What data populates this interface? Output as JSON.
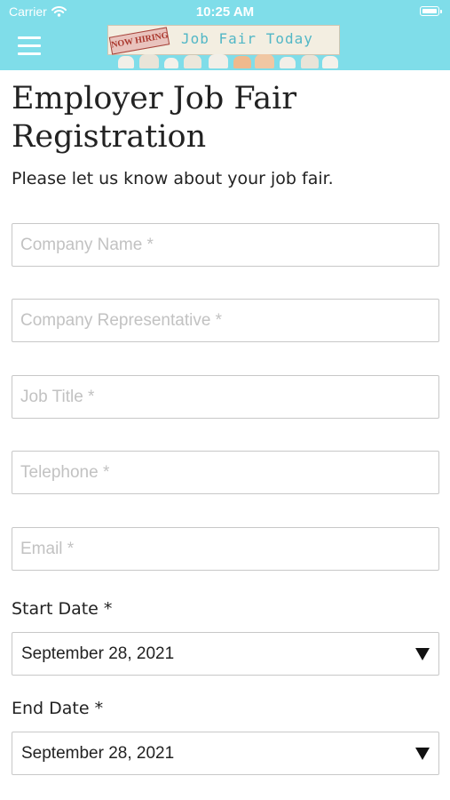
{
  "status_bar": {
    "carrier": "Carrier",
    "time": "10:25 AM"
  },
  "header": {
    "logo_badge": "NOW HIRING",
    "logo_title": "Job Fair Today",
    "colors": {
      "bar": "#7fdde9",
      "logo_title": "#52b7c6"
    }
  },
  "page": {
    "title": "Employer Job Fair Registration",
    "subtitle": "Please let us know about your job fair."
  },
  "form": {
    "fields": [
      {
        "placeholder": "Company Name *",
        "value": ""
      },
      {
        "placeholder": "Company Representative *",
        "value": ""
      },
      {
        "placeholder": "Job Title *",
        "value": ""
      },
      {
        "placeholder": "Telephone *",
        "value": ""
      },
      {
        "placeholder": "Email *",
        "value": ""
      }
    ],
    "start_date": {
      "label": "Start Date *",
      "selected": "September 28, 2021"
    },
    "end_date": {
      "label": "End Date *",
      "selected": "September 28, 2021"
    }
  },
  "icons": {
    "menu": "hamburger-menu-icon",
    "wifi": "wifi-icon",
    "battery": "battery-icon",
    "dropdown": "triangle-down-icon"
  }
}
